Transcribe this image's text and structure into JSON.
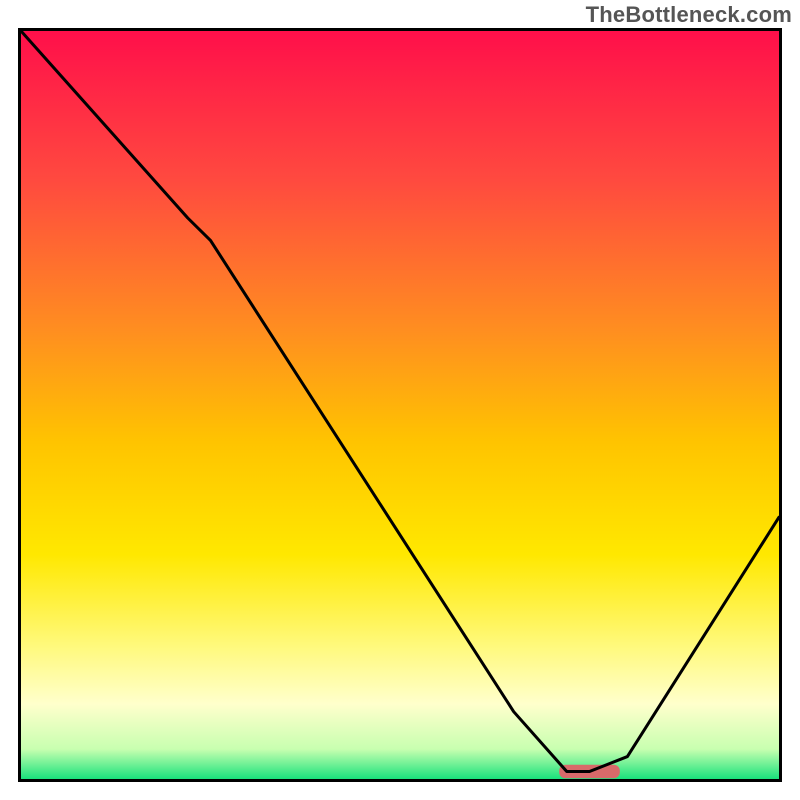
{
  "watermark": "TheBottleneck.com",
  "chart_data": {
    "type": "line",
    "title": "",
    "xlabel": "",
    "ylabel": "",
    "xlim": [
      0,
      100
    ],
    "ylim": [
      0,
      100
    ],
    "series": [
      {
        "name": "bottleneck-curve",
        "color": "#000000",
        "x": [
          0,
          22,
          25,
          65,
          72,
          75,
          80,
          100
        ],
        "values": [
          100,
          75,
          72,
          9,
          1,
          1,
          3,
          35
        ]
      }
    ],
    "marker": {
      "name": "optimal-marker",
      "x0": 71,
      "x1": 79,
      "y": 1,
      "color": "#d86a6a"
    },
    "background": {
      "type": "linear-gradient-vertical",
      "stops": [
        {
          "offset": 0.0,
          "color": "#ff0f4a"
        },
        {
          "offset": 0.2,
          "color": "#ff4a3f"
        },
        {
          "offset": 0.4,
          "color": "#ff8e20"
        },
        {
          "offset": 0.55,
          "color": "#ffc400"
        },
        {
          "offset": 0.7,
          "color": "#ffe800"
        },
        {
          "offset": 0.82,
          "color": "#fff97a"
        },
        {
          "offset": 0.9,
          "color": "#ffffcc"
        },
        {
          "offset": 0.96,
          "color": "#c8ffb0"
        },
        {
          "offset": 1.0,
          "color": "#19e27c"
        }
      ]
    }
  }
}
